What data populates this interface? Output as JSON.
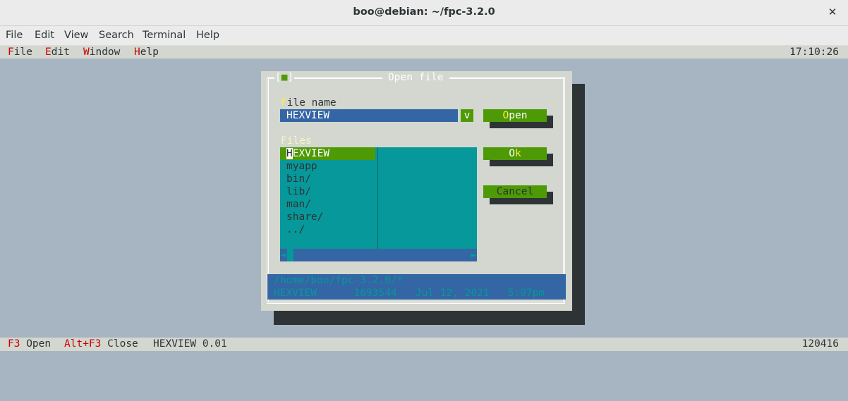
{
  "window": {
    "title": "boo@debian: ~/fpc-3.2.0",
    "close_glyph": "✕"
  },
  "terminal_menu": [
    "File",
    "Edit",
    "View",
    "Search",
    "Terminal",
    "Help"
  ],
  "tv_menu": [
    {
      "hot": "F",
      "rest": "ile"
    },
    {
      "hot": "E",
      "rest": "dit"
    },
    {
      "hot": "W",
      "rest": "indow"
    },
    {
      "hot": "H",
      "rest": "elp"
    }
  ],
  "clock": "17:10:26",
  "dialog": {
    "close_box_left": "[",
    "close_box_glyph": "■",
    "close_box_right": "]",
    "title": "Open file",
    "file_name_label": {
      "hot": "F",
      "rest": "ile name"
    },
    "file_name_value": "HEXVIEW",
    "history_button": "v",
    "files_label": {
      "hot": "F",
      "rest": "iles"
    },
    "files": [
      {
        "cursor": "H",
        "rest": "EXVIEW"
      },
      "myapp",
      "bin/",
      "lib/",
      "man/",
      "share/",
      "../"
    ],
    "scroll_left": "◄",
    "scroll_right": "►",
    "buttons": {
      "open": {
        "hot": "O",
        "rest": "pen"
      },
      "ok": {
        "pre": "O",
        "hot": "k"
      },
      "cancel": "Cancel"
    },
    "info": {
      "path": "/home/boo/fpc-3.2.0/*",
      "file_line": "HEXVIEW      1693544   Jul 12, 2021   5:07pm"
    }
  },
  "status_bar": {
    "f3_key": "F3",
    "f3_label": "Open",
    "altf3_key": "Alt+F3",
    "altf3_label": "Close",
    "app": "HEXVIEW 0.01",
    "right": "120416"
  },
  "colors": {
    "desktop": "#a7b5c2",
    "dialog": "#d3d7cf",
    "input": "#3465a4",
    "list": "#06989a",
    "button": "#4e9a06",
    "hotkey": "#cc0000",
    "highlight": "#fce94f"
  }
}
